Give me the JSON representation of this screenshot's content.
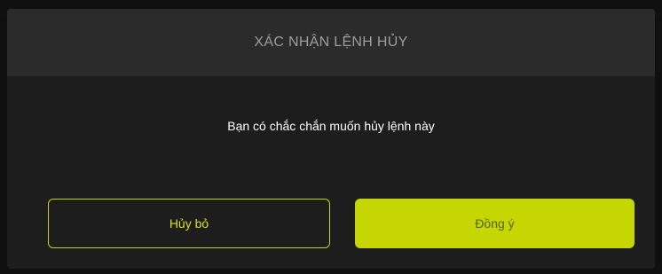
{
  "dialog": {
    "title": "XÁC NHẬN LỆNH HỦY",
    "message": "Bạn có chắc chắn muốn hủy lệnh này",
    "cancel_label": "Hủy bỏ",
    "confirm_label": "Đồng ý"
  },
  "colors": {
    "accent": "#c6d603",
    "dialog_bg": "#1c1d1c",
    "header_bg": "#2a2b2a"
  }
}
